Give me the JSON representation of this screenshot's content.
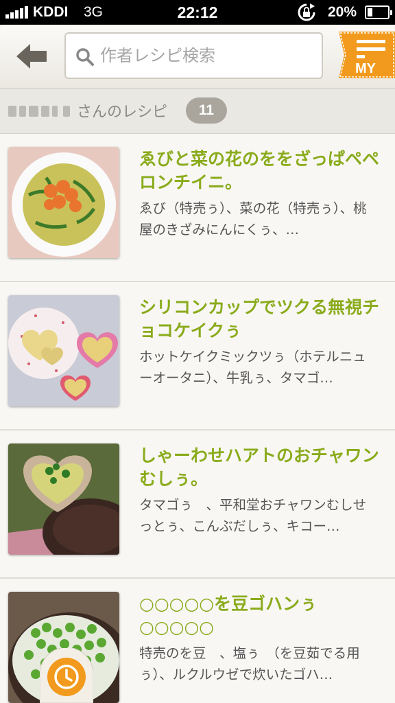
{
  "statusbar": {
    "carrier": "KDDI",
    "network": "3G",
    "time": "22:12",
    "battery": "20%"
  },
  "search": {
    "placeholder": "作者レシピ検索"
  },
  "my_button": {
    "label": "MY"
  },
  "subheader": {
    "suffix": "さんのレシピ",
    "count": "11"
  },
  "recipes": [
    {
      "title": "ゑびと菜の花のををざっぱペペロンチイニ。",
      "description": "ゑび（特売ぅ）、菜の花（特売ぅ）、桃屋のきざみにんにくぅ、…"
    },
    {
      "title": "シリコンカップでツクる無視チョコケイクぅ",
      "description": "ホットケイクミックツぅ（ホテルニューオータニ）、牛乳ぅ、タマゴ…"
    },
    {
      "title": "しゃーわせハアトのおチャワンむしぅ。",
      "description": "タマゴぅ　、平和堂おチャワンむしせっとぅ、こんぶだしぅ、キコー…"
    },
    {
      "title": "○○○○○を豆ゴハンぅ○○○○○",
      "description": "特売のを豆　、塩ぅ　（を豆茹でる用ぅ）、ルクルウゼで炊いたゴハ…"
    }
  ],
  "colors": {
    "title_green": "#8aab1b",
    "my_orange": "#f29a1d",
    "badge_gray": "#aaa69e"
  },
  "icons": [
    "back-arrow-icon",
    "search-icon",
    "menu-lines-icon",
    "clock-icon",
    "lock-rotation-icon",
    "battery-icon",
    "signal-icon"
  ]
}
